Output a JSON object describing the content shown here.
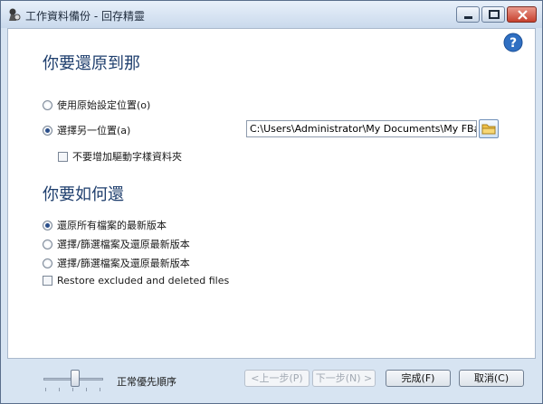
{
  "window": {
    "title": "工作資料備份 - 回存精靈",
    "icons": {
      "app": "backup-app-icon",
      "minimize": "minimize-icon",
      "maximize": "maximize-icon",
      "close": "close-icon",
      "help": "help-icon"
    }
  },
  "restore_location": {
    "heading": "你要還原到那",
    "options": [
      {
        "label": "使用原始設定位置(o)",
        "selected": false
      },
      {
        "label": "選擇另一位置(a)",
        "selected": true
      }
    ],
    "path_value": "C:\\Users\\Administrator\\My Documents\\My FBac",
    "browse_icon": "folder-icon",
    "no_drive_folder_label": "不要增加驅動字樣資料夾",
    "no_drive_folder_checked": false
  },
  "restore_method": {
    "heading": "你要如何還",
    "options": [
      {
        "label": "還原所有檔案的最新版本",
        "selected": true
      },
      {
        "label": "選擇/篩選檔案及還原最新版本",
        "selected": false
      },
      {
        "label": "選擇/篩選檔案及還原最新版本",
        "selected": false
      }
    ],
    "restore_excluded_label": "Restore excluded and deleted files",
    "restore_excluded_checked": false
  },
  "footer": {
    "priority_label": "正常優先順序",
    "buttons": {
      "back": "<上一步(P)",
      "next": "下一步(N) >",
      "finish": "完成(F)",
      "cancel": "取消(C)"
    }
  }
}
